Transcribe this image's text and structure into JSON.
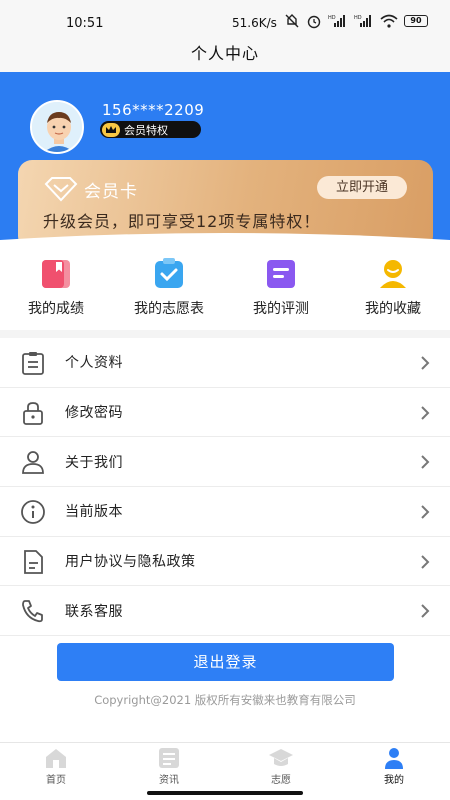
{
  "status_bar": {
    "time": "10:51",
    "network_speed": "51.6K/s",
    "battery": "90",
    "icons": [
      "mute-icon",
      "alarm-icon",
      "hd-signal-icon",
      "hd-signal-icon",
      "wifi-icon",
      "battery-icon"
    ]
  },
  "header": {
    "title": "个人中心",
    "accent_color": "#2c7df2"
  },
  "profile": {
    "phone": "156****2209",
    "vip_label": "会员特权"
  },
  "member_card": {
    "title": "会员卡",
    "button_label": "立即开通",
    "description": "升级会员，即可享受12项专属特权！"
  },
  "quick_actions": [
    {
      "label": "我的成绩",
      "icon": "bookmark-book-icon",
      "color": "#f0506e"
    },
    {
      "label": "我的志愿表",
      "icon": "clipboard-check-icon",
      "color": "#3aa6f0"
    },
    {
      "label": "我的评测",
      "icon": "document-icon",
      "color": "#8a58f0"
    },
    {
      "label": "我的收藏",
      "icon": "user-star-icon",
      "color": "#f5b800"
    }
  ],
  "menu": [
    {
      "label": "个人资料",
      "icon": "profile-doc-icon"
    },
    {
      "label": "修改密码",
      "icon": "lock-icon"
    },
    {
      "label": "关于我们",
      "icon": "user-icon"
    },
    {
      "label": "当前版本",
      "icon": "info-icon"
    },
    {
      "label": "用户协议与隐私政策",
      "icon": "file-icon"
    },
    {
      "label": "联系客服",
      "icon": "phone-icon"
    }
  ],
  "logout_label": "退出登录",
  "copyright": "Copyright@2021 版权所有安徽来也教育有限公司",
  "tabbar": [
    {
      "label": "首页",
      "icon": "home-icon",
      "active": false
    },
    {
      "label": "资讯",
      "icon": "news-icon",
      "active": false
    },
    {
      "label": "志愿",
      "icon": "graduation-cap-icon",
      "active": false
    },
    {
      "label": "我的",
      "icon": "person-icon",
      "active": true
    }
  ]
}
